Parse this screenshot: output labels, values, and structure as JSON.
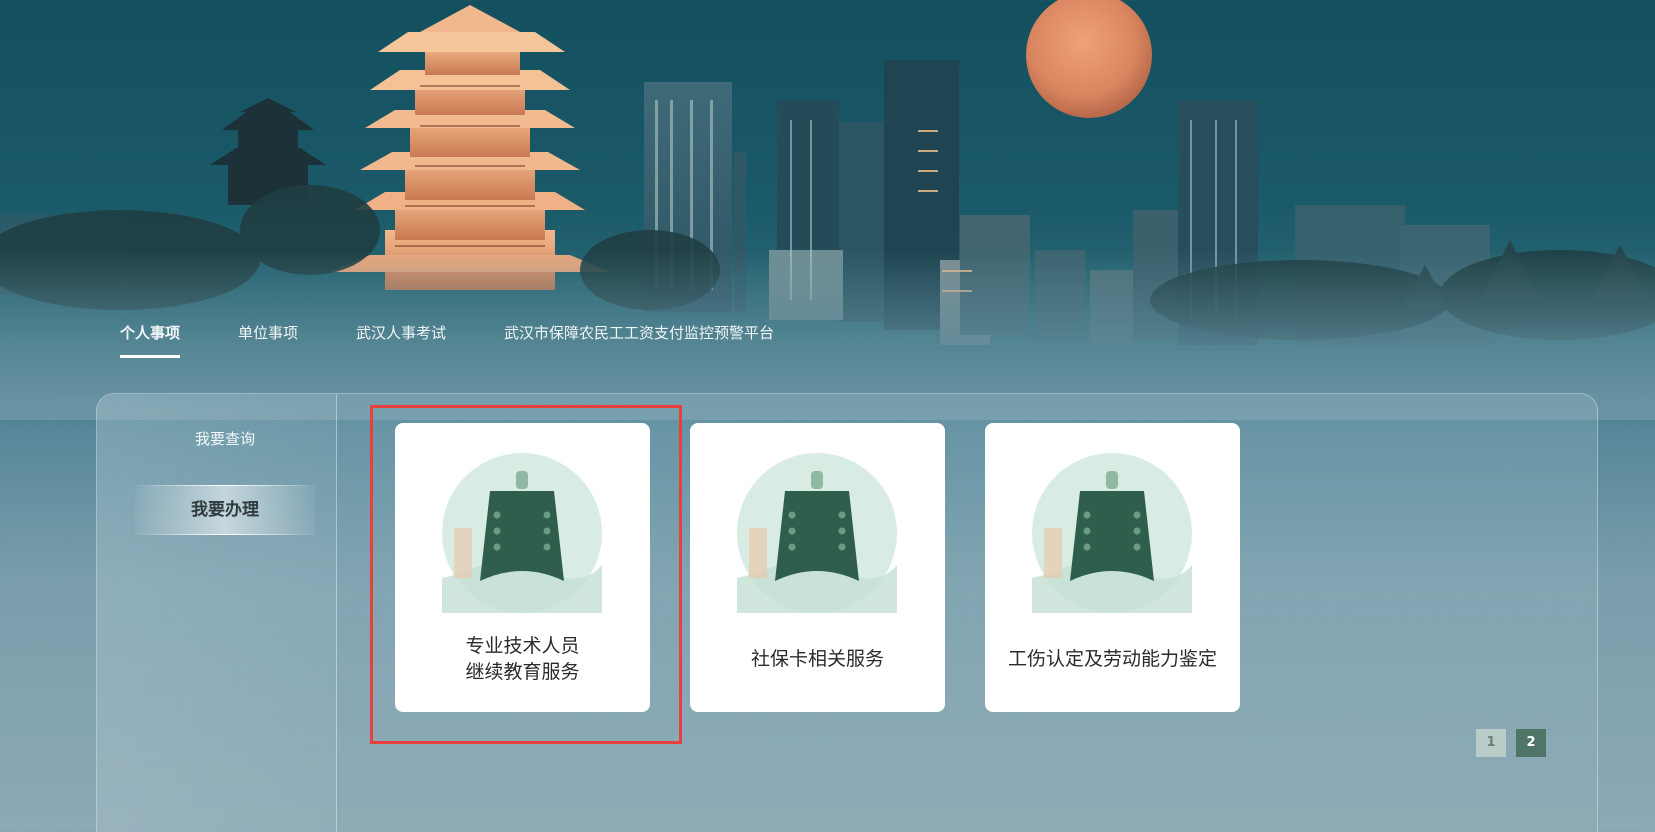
{
  "nav": {
    "tabs": [
      {
        "label": "个人事项",
        "active": true
      },
      {
        "label": "单位事项",
        "active": false
      },
      {
        "label": "武汉人事考试",
        "active": false
      },
      {
        "label": "武汉市保障农民工工资支付监控预警平台",
        "active": false
      }
    ]
  },
  "sidebar": {
    "items": [
      {
        "label": "我要查询",
        "active": false
      },
      {
        "label": "我要办理",
        "active": true
      }
    ]
  },
  "cards": [
    {
      "line1": "专业技术人员",
      "line2": "继续教育服务",
      "icon": "bronze-bell-icon",
      "highlighted": true
    },
    {
      "label": "社保卡相关服务",
      "icon": "bronze-bell-icon",
      "highlighted": false
    },
    {
      "label": "工伤认定及劳动能力鉴定",
      "icon": "bronze-bell-icon",
      "highlighted": false
    }
  ],
  "pagination": {
    "pages": [
      "1",
      "2"
    ],
    "current": "2"
  },
  "colors": {
    "highlight_border": "#e8413d",
    "active_page": "#4e7566",
    "inactive_page": "#b8cdc7",
    "icon_circle": "#d9ece4",
    "bell": "#2f5e4c"
  }
}
